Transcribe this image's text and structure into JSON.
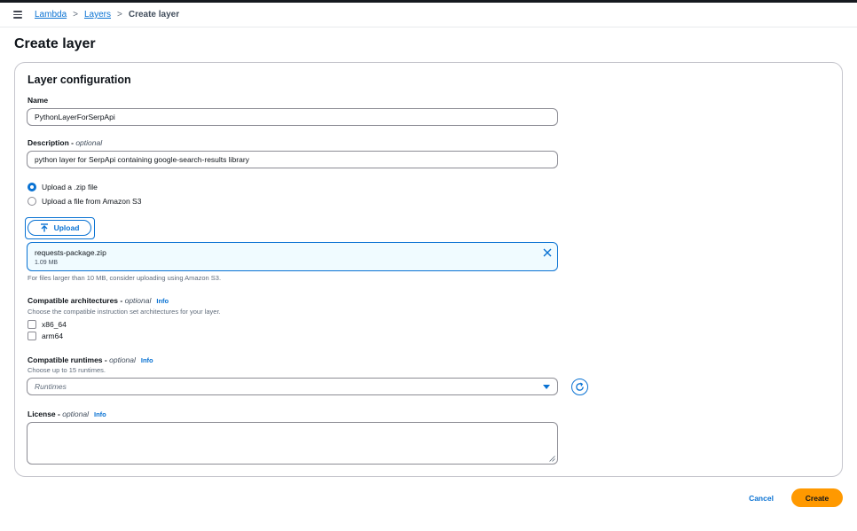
{
  "breadcrumb": {
    "items": [
      {
        "label": "Lambda"
      },
      {
        "label": "Layers"
      }
    ],
    "current": "Create layer"
  },
  "page": {
    "title": "Create layer"
  },
  "layer_configuration": {
    "title": "Layer configuration",
    "name": {
      "label": "Name",
      "value": "PythonLayerForSerpApi"
    },
    "description": {
      "label": "Description",
      "optional": "optional",
      "value": "python layer for SerpApi containing google-search-results library"
    },
    "upload_options": [
      {
        "label": "Upload a .zip file",
        "checked": true
      },
      {
        "label": "Upload a file from Amazon S3",
        "checked": false
      }
    ],
    "upload_button": "Upload",
    "file": {
      "name": "requests-package.zip",
      "size": "1.09 MB"
    },
    "file_hint": "For files larger than 10 MB, consider uploading using Amazon S3.",
    "architectures": {
      "label": "Compatible architectures",
      "optional": "optional",
      "info": "Info",
      "hint": "Choose the compatible instruction set architectures for your layer.",
      "options": [
        {
          "label": "x86_64",
          "checked": false
        },
        {
          "label": "arm64",
          "checked": false
        }
      ]
    },
    "runtimes": {
      "label": "Compatible runtimes",
      "optional": "optional",
      "info": "Info",
      "hint": "Choose up to 15 runtimes.",
      "placeholder": "Runtimes"
    },
    "license": {
      "label": "License",
      "optional": "optional",
      "info": "Info",
      "value": ""
    }
  },
  "actions": {
    "cancel": "Cancel",
    "create": "Create"
  },
  "colors": {
    "accent": "#0972d3",
    "primary_button": "#ff9900",
    "text": "#0f141a"
  }
}
